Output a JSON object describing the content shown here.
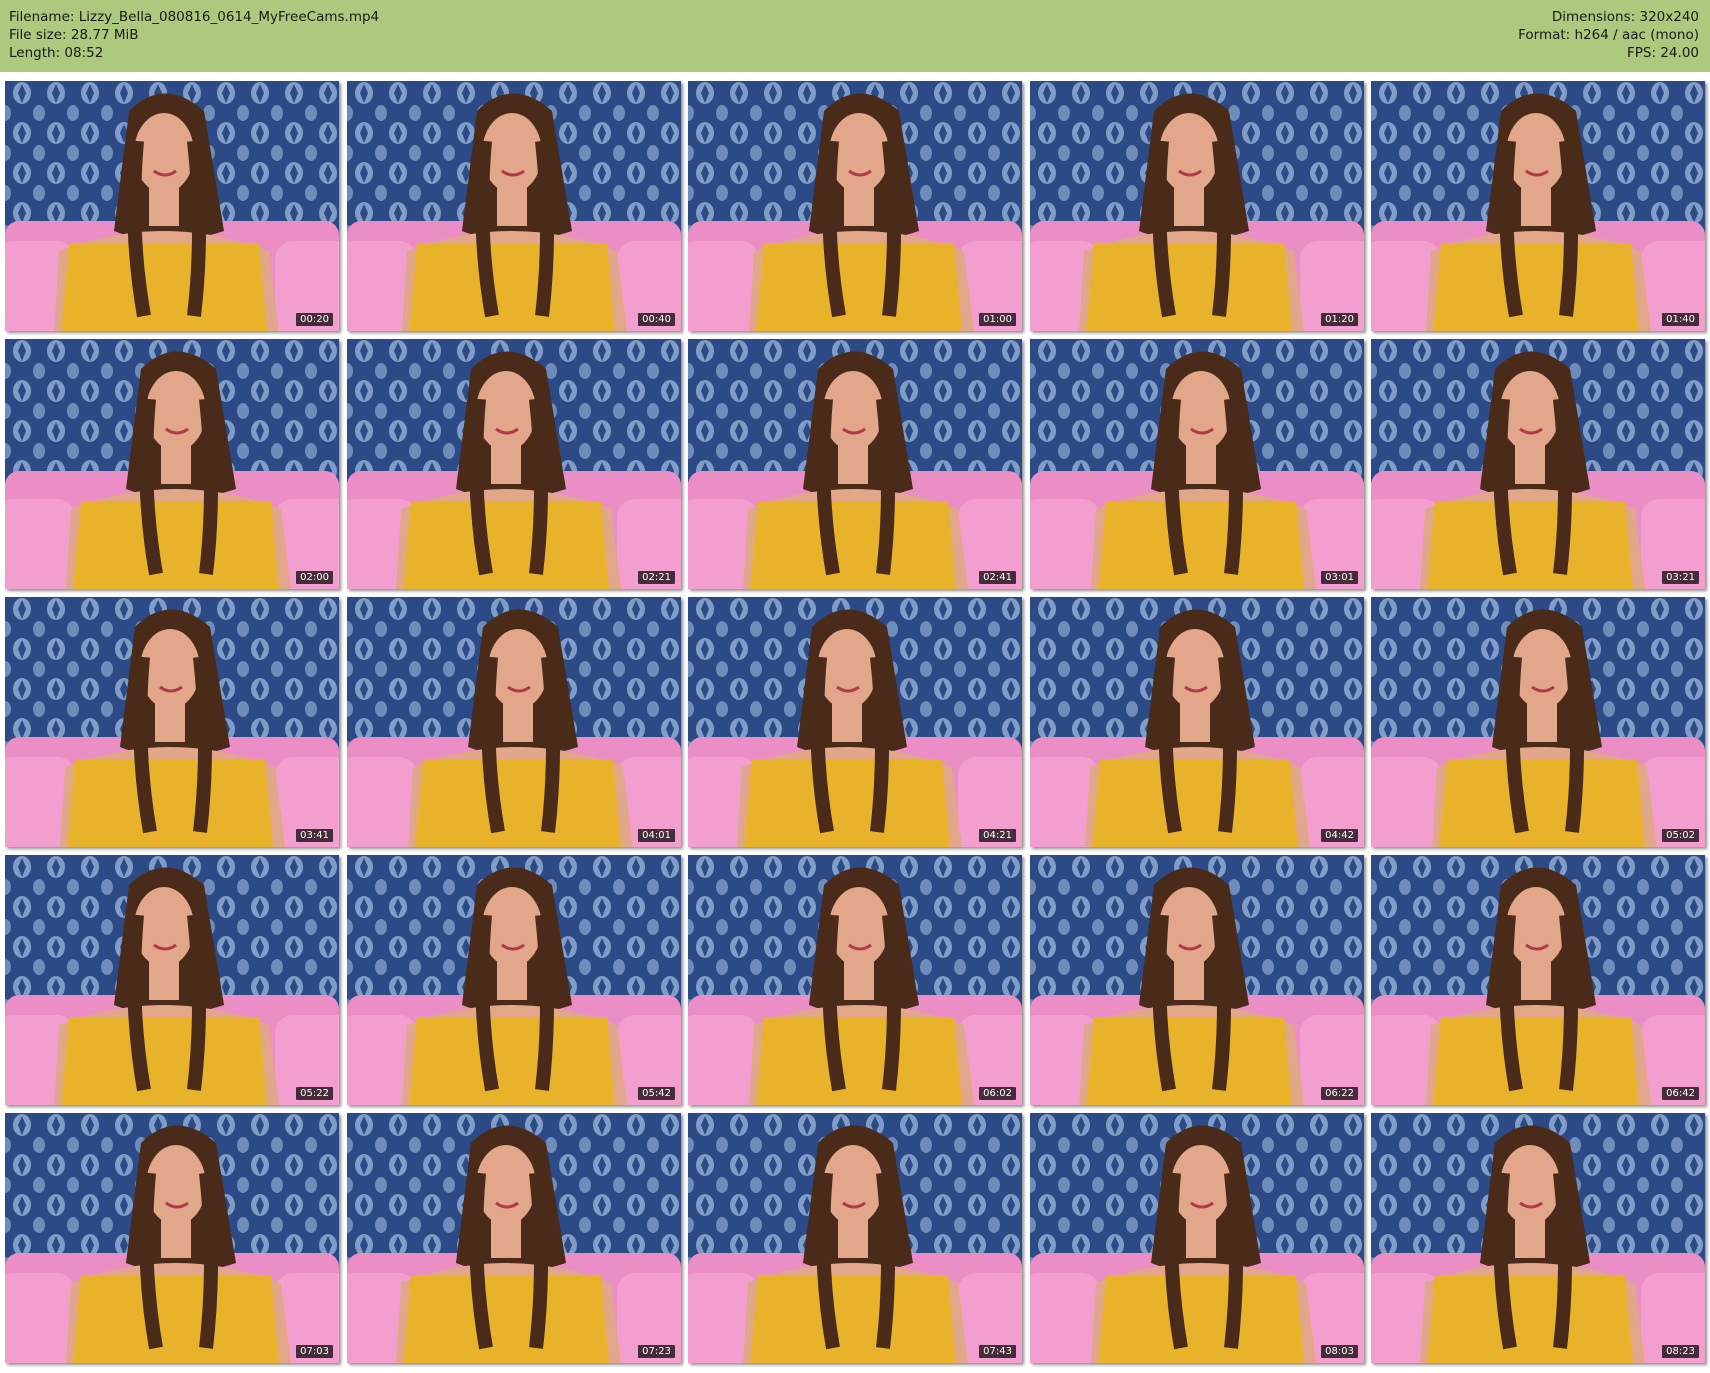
{
  "header": {
    "filename": "Filename: Lizzy_Bella_080816_0614_MyFreeCams.mp4",
    "file_size": "File size: 28.77 MiB",
    "length": "Length: 08:52",
    "dimensions": "Dimensions: 320x240",
    "format": "Format: h264 / aac (mono)",
    "fps": "FPS: 24.00"
  },
  "colors": {
    "header_bg": "#acc97e",
    "wallpaper": "#2c4a86",
    "wallpaper_light": "#9cb8dc",
    "sofa": "#ec8ec6",
    "top": "#e8b22a",
    "hair": "#4a2a18",
    "skin": "#e2a68a"
  },
  "thumbnails": [
    {
      "time": "00:20"
    },
    {
      "time": "00:40"
    },
    {
      "time": "01:00"
    },
    {
      "time": "01:20"
    },
    {
      "time": "01:40"
    },
    {
      "time": "02:00"
    },
    {
      "time": "02:21"
    },
    {
      "time": "02:41"
    },
    {
      "time": "03:01"
    },
    {
      "time": "03:21"
    },
    {
      "time": "03:41"
    },
    {
      "time": "04:01"
    },
    {
      "time": "04:21"
    },
    {
      "time": "04:42"
    },
    {
      "time": "05:02"
    },
    {
      "time": "05:22"
    },
    {
      "time": "05:42"
    },
    {
      "time": "06:02"
    },
    {
      "time": "06:22"
    },
    {
      "time": "06:42"
    },
    {
      "time": "07:03"
    },
    {
      "time": "07:23"
    },
    {
      "time": "07:43"
    },
    {
      "time": "08:03"
    },
    {
      "time": "08:23"
    }
  ]
}
